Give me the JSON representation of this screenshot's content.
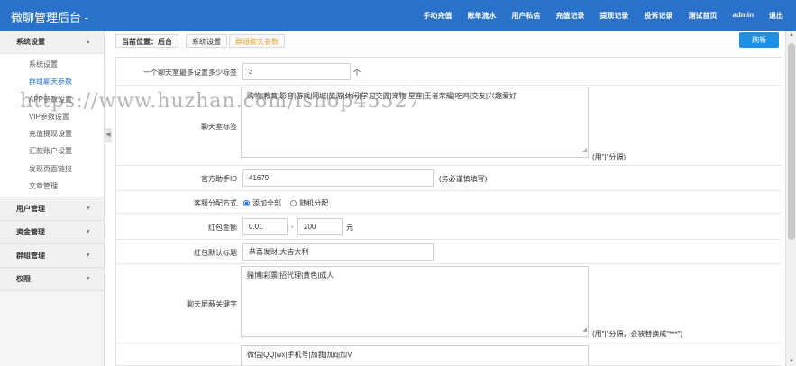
{
  "header": {
    "brand": "微聊管理后台 -",
    "nav": [
      "手动充值",
      "账单流水",
      "用户私信",
      "充值记录",
      "提现记录",
      "投诉记录",
      "测试首页",
      "admin",
      "退出"
    ]
  },
  "sidebar": {
    "groups": [
      {
        "label": "系统设置",
        "chevron": "▲",
        "items": [
          "系统设置",
          "群组聊天参数",
          "APP参数设置",
          "VIP参数设置",
          "充值提现设置",
          "汇款账户设置",
          "发现页面链接",
          "文章管理"
        ]
      },
      {
        "label": "用户管理",
        "chevron": "▼"
      },
      {
        "label": "资金管理",
        "chevron": "▼"
      },
      {
        "label": "群组管理",
        "chevron": "▼"
      },
      {
        "label": "权限",
        "chevron": "▼"
      }
    ],
    "collapse": "◀"
  },
  "breadcrumb": {
    "prefix": "当前位置：后台",
    "section": "系统设置",
    "current": "群组聊天参数"
  },
  "refresh_label": "刷新",
  "form": {
    "max_tags": {
      "label": "一个聊天室最多设置多少标签",
      "value": "3",
      "unit": "个"
    },
    "room_tags": {
      "label": "聊天室标签",
      "value": "购物|教育|影音|游戏|同城|旅游|休闲|学习交流|宠物|星座|王者荣耀|吃鸡|交友|兴趣爱好",
      "hint": "(用\"|\"分隔)"
    },
    "helper_id": {
      "label": "官方助手ID",
      "value": "41679",
      "hint": "(务必谨慎填写)"
    },
    "service_mode": {
      "label": "客服分配方式",
      "options": [
        "添加全部",
        "随机分配"
      ]
    },
    "redpacket_amount": {
      "label": "红包金额",
      "min": "0.01",
      "sep": "-",
      "max": "200",
      "unit": "元"
    },
    "redpacket_title": {
      "label": "红包默认标题",
      "value": "恭喜发财,大吉大利"
    },
    "blocked_words": {
      "label": "聊天屏蔽关键字",
      "value": "赌博|彩票|招代理|黄色|成人",
      "hint": "(用\"|\"分隔，会被替换成\"***\")"
    },
    "contact_words": {
      "value": "微信|QQ|wx|手机号|加我|加q|加V"
    }
  },
  "watermark": "https://www.huzhan.com/ishop45527",
  "colors": {
    "topbar": "#2a72c9",
    "refresh": "#1e8fe1",
    "active_link": "#2a72c9",
    "current_crumb": "#e0a020"
  }
}
